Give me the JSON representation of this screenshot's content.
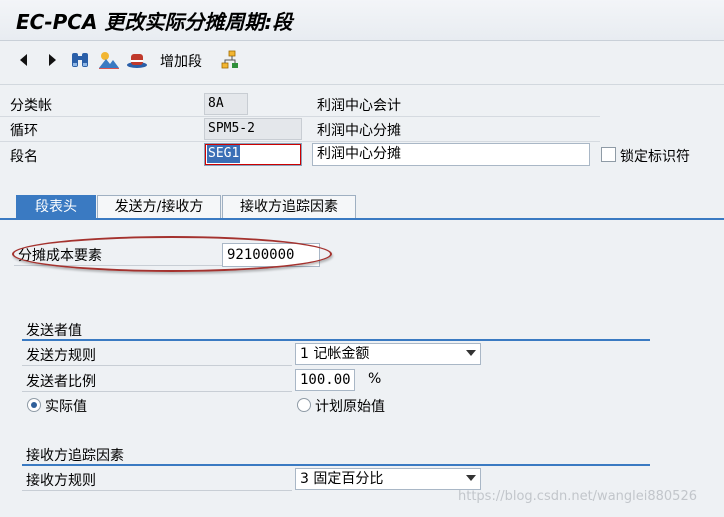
{
  "title": "EC-PCA 更改实际分摊周期:段",
  "toolbar": {
    "icons": [
      "arrow-left-icon",
      "arrow-right-icon",
      "binoculars-icon",
      "landscape-icon",
      "hat-icon",
      "hierarchy-icon"
    ],
    "add_segment_label": "增加段"
  },
  "header": {
    "ledger": {
      "label": "分类帐",
      "value": "8A",
      "desc": "利润中心会计"
    },
    "cycle": {
      "label": "循环",
      "value": "SPM5-2",
      "desc": "利润中心分摊"
    },
    "segment": {
      "label": "段名",
      "value": "SEG1",
      "desc": "利润中心分摊"
    },
    "lock_label": "锁定标识符"
  },
  "tabs": [
    {
      "label": "段表头"
    },
    {
      "label": "发送方/接收方"
    },
    {
      "label": "接收方追踪因素"
    }
  ],
  "cost_element": {
    "label": "分摊成本要素",
    "value": "92100000"
  },
  "sender_values": {
    "title": "发送者值",
    "rule_label": "发送方规则",
    "rule_value": "1 记帐金额",
    "pct_label": "发送者比例",
    "pct_value": "100.00",
    "pct_unit": "%",
    "radio_actual": "实际值",
    "radio_plan": "计划原始值"
  },
  "receiver_tracing": {
    "title": "接收方追踪因素",
    "rule_label": "接收方规则",
    "rule_value": "3 固定百分比"
  },
  "watermark": "https://blog.csdn.net/wanglei880526"
}
